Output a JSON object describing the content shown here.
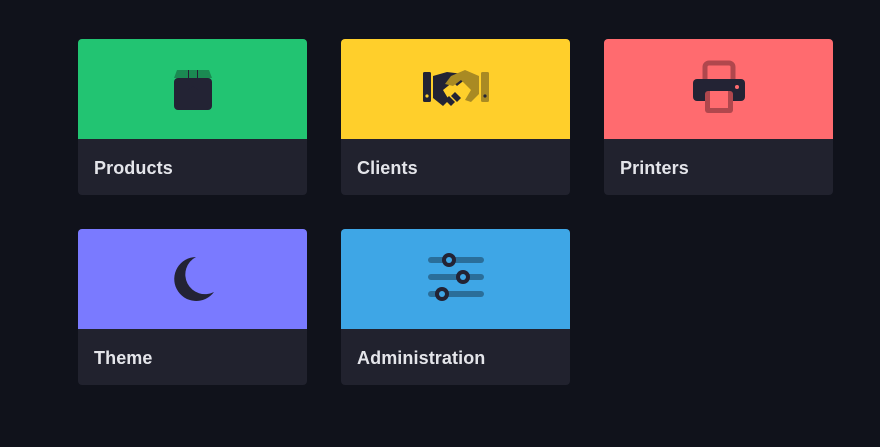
{
  "tiles": [
    {
      "label": "Products",
      "icon": "box-icon",
      "color": "#22c472"
    },
    {
      "label": "Clients",
      "icon": "handshake-icon",
      "color": "#ffcf2b"
    },
    {
      "label": "Printers",
      "icon": "printer-icon",
      "color": "#ff6b6f"
    },
    {
      "label": "Theme",
      "icon": "moon-icon",
      "color": "#7a7aff"
    },
    {
      "label": "Administration",
      "icon": "sliders-icon",
      "color": "#3ea6e6"
    }
  ],
  "colors": {
    "background": "#10121b",
    "card_body": "#21222e",
    "icon_dark": "#232334"
  }
}
